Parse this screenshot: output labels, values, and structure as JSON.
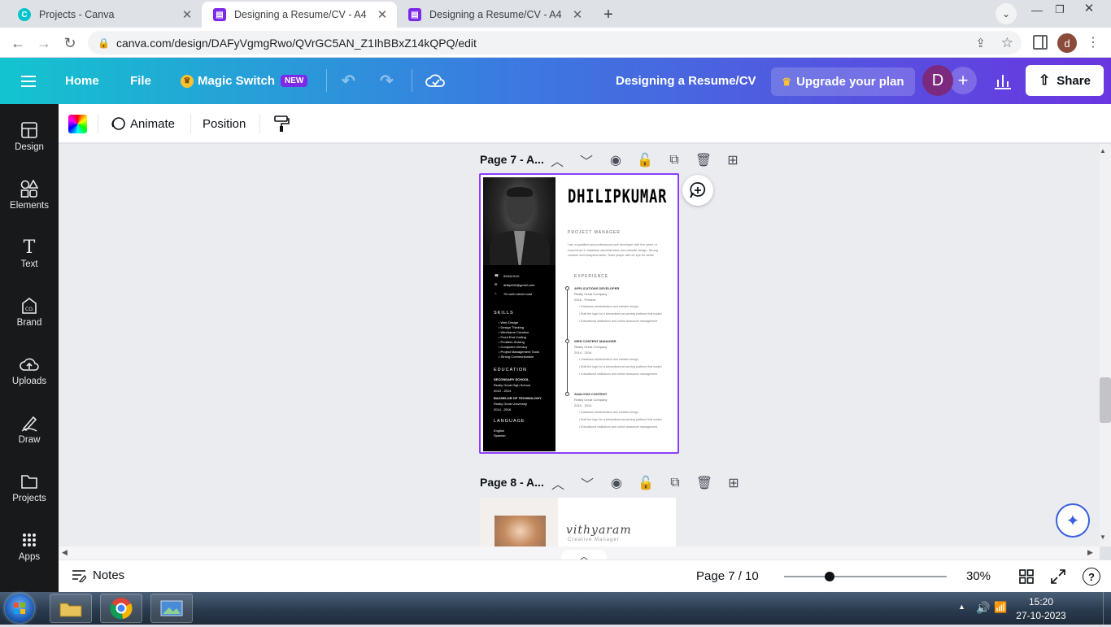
{
  "browser": {
    "tabs": [
      {
        "title": "Projects - Canva",
        "active": false
      },
      {
        "title": "Designing a Resume/CV - A4",
        "active": true
      },
      {
        "title": "Designing a Resume/CV - A4",
        "active": false
      }
    ],
    "url": "canva.com/design/DAFyVgmgRwo/QVrGC5AN_Z1IhBBxZ14kQPQ/edit",
    "profile_initial": "d"
  },
  "header": {
    "home": "Home",
    "file": "File",
    "magic_switch": "Magic Switch",
    "new_badge": "NEW",
    "doc_title": "Designing a Resume/CV",
    "upgrade": "Upgrade your plan",
    "avatar_initial": "D",
    "share": "Share"
  },
  "sidebar": {
    "items": [
      {
        "label": "Design",
        "icon": "design-icon"
      },
      {
        "label": "Elements",
        "icon": "elements-icon"
      },
      {
        "label": "Text",
        "icon": "text-icon"
      },
      {
        "label": "Brand",
        "icon": "brand-icon"
      },
      {
        "label": "Uploads",
        "icon": "uploads-icon"
      },
      {
        "label": "Draw",
        "icon": "draw-icon"
      },
      {
        "label": "Projects",
        "icon": "projects-icon"
      },
      {
        "label": "Apps",
        "icon": "apps-icon"
      }
    ]
  },
  "toolbar": {
    "animate": "Animate",
    "position": "Position"
  },
  "pages": {
    "page7_label": "Page 7 - A...",
    "page8_label": "Page 8 - A..."
  },
  "resume": {
    "name": "DHILIPKUMAR",
    "role": "PROJECT MANAGER",
    "summary": "I am a qualified and professional web developer with five years of experience in database administration and website design. Strong creative and analytical skills. Team player with an eye for detail.",
    "contact": [
      "9934XXXX",
      "dhilip842@gmail.com",
      "76 north street road"
    ],
    "skills_heading": "SKILLS",
    "skills": [
      "Web Design",
      "Design Thinking",
      "Wireframe Creation",
      "Front End Coding",
      "Problem-Solving",
      "Computer Literacy",
      "Project Management Tools",
      "Strong Communication"
    ],
    "education_heading": "EDUCATION",
    "education": [
      {
        "school": "SECONDARY SCHOOL",
        "place": "Really Great High School",
        "years": "2010 - 2014"
      },
      {
        "school": "BACHELOR OF TECHNOLOGY",
        "place": "Really Great University",
        "years": "2014 - 2016"
      }
    ],
    "language_heading": "LANGUAGE",
    "languages": [
      "English",
      "Spanish"
    ],
    "experience_heading": "EXPERIENCE",
    "experience": [
      {
        "title": "APPLICATIONS DEVELOPER",
        "company": "Really Great Company",
        "years": "2016 - Present",
        "bullets": [
          "Database administration and website design",
          "Built the logic for a streamlined ad-serving platform that scaled",
          "Educational institutions and online classroom management"
        ]
      },
      {
        "title": "WEB CONTENT MANAGER",
        "company": "Really Great Company",
        "years": "2014 - 2016",
        "bullets": [
          "Database administration and website design",
          "Built the logic for a streamlined ad-serving platform that scaled",
          "Educational institutions and online classroom management"
        ]
      },
      {
        "title": "ANALYSIS CONTENT",
        "company": "Really Great Company",
        "years": "2010 - 2014",
        "bullets": [
          "Database administration and website design",
          "Built the logic for a streamlined ad-serving platform that scaled",
          "Educational institutions and online classroom management"
        ]
      }
    ]
  },
  "page8": {
    "name": "vithyaram",
    "role": "Creative Manager"
  },
  "bottombar": {
    "notes": "Notes",
    "page_indicator": "Page 7 / 10",
    "zoom": "30%",
    "zoom_fraction": 0.3
  },
  "taskbar": {
    "time": "15:20",
    "date": "27-10-2023"
  },
  "colors": {
    "accent": "#8b3dff",
    "header_start": "#13c4cf",
    "header_end": "#6a35e0",
    "sidebar": "#18191b"
  }
}
